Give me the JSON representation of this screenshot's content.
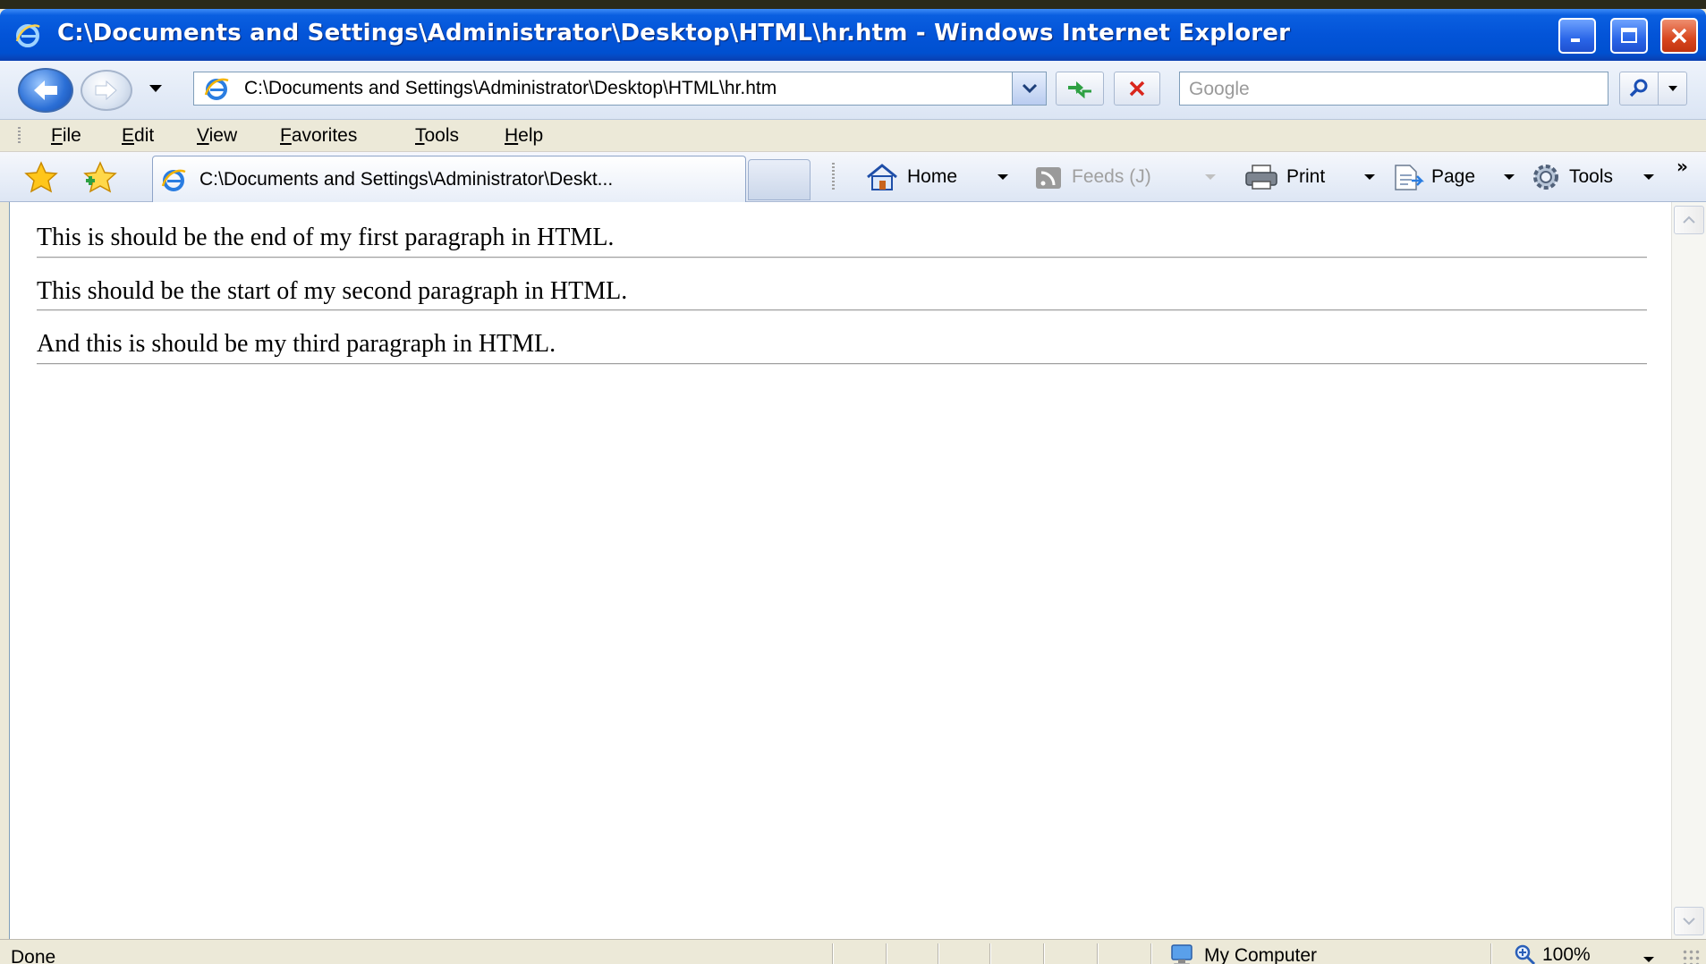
{
  "window": {
    "title": "C:\\Documents and Settings\\Administrator\\Desktop\\HTML\\hr.htm - Windows Internet Explorer"
  },
  "address_bar": {
    "url": "C:\\Documents and Settings\\Administrator\\Desktop\\HTML\\hr.htm"
  },
  "search": {
    "placeholder": "Google"
  },
  "menu": {
    "items": [
      "File",
      "Edit",
      "View",
      "Favorites",
      "Tools",
      "Help"
    ]
  },
  "tab": {
    "label": "C:\\Documents and Settings\\Administrator\\Deskt..."
  },
  "commands": {
    "home": "Home",
    "feeds": "Feeds (J)",
    "print": "Print",
    "page": "Page",
    "tools": "Tools"
  },
  "content": {
    "paragraphs": [
      "This is should be the end of my first paragraph in HTML.",
      "This should be the start of my second paragraph in HTML.",
      "And this is should be my third paragraph in HTML."
    ]
  },
  "status": {
    "text": "Done",
    "zone": "My Computer",
    "zoom": "100%"
  },
  "icons": {
    "app": "ie-icon",
    "favorites": "star-icon",
    "add_favorites": "add-favorite-icon",
    "home": "home-icon",
    "feeds": "rss-icon",
    "print": "printer-icon",
    "page": "page-icon",
    "tools": "gear-icon",
    "zone": "computer-icon",
    "zoom": "magnifier-icon"
  }
}
